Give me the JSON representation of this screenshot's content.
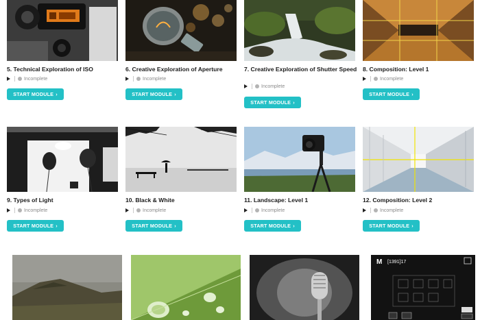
{
  "status_label": "Incomplete",
  "button_label": "START MODULE",
  "button_chevron": "›",
  "accent_color": "#23c0c6",
  "modules": [
    {
      "title": "5. Technical Exploration of ISO",
      "thumb": "camera-iso-screen"
    },
    {
      "title": "6. Creative Exploration of Aperture",
      "thumb": "lightbulb-bokeh"
    },
    {
      "title": "7. Creative Exploration of Shutter Speed",
      "thumb": "waterfall-long-exposure"
    },
    {
      "title": "8. Composition: Level 1",
      "thumb": "ceiling-grid"
    },
    {
      "title": "9. Types of Light",
      "thumb": "studio-lighting"
    },
    {
      "title": "10. Black & White",
      "thumb": "bw-silhouette-umbrella"
    },
    {
      "title": "11. Landscape: Level 1",
      "thumb": "camera-on-tripod-landscape"
    },
    {
      "title": "12. Composition: Level 2",
      "thumb": "corridor-grid"
    }
  ],
  "partial_row": [
    {
      "thumb": "hill-landscape"
    },
    {
      "thumb": "leaf-water-drop"
    },
    {
      "thumb": "microphone"
    },
    {
      "thumb": "camera-settings-screen",
      "screen_mode": "M",
      "screen_shots": "[1391]17"
    }
  ]
}
